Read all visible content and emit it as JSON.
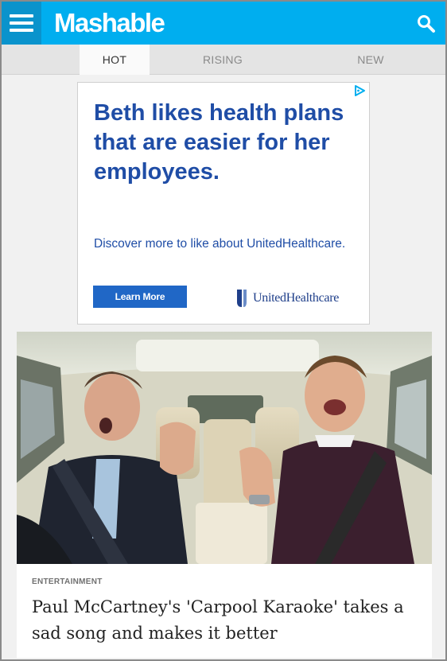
{
  "header": {
    "logo_text": "Mashable",
    "menu_icon": "hamburger-menu-icon",
    "search_icon": "search-icon",
    "brand_color": "#00aeef"
  },
  "tabs": [
    {
      "label": "HOT",
      "active": true
    },
    {
      "label": "RISING",
      "active": false
    },
    {
      "label": "NEW",
      "active": false
    }
  ],
  "ad": {
    "headline": "Beth likes health plans that are easier for her employees.",
    "body": "Discover more to like about UnitedHealthcare.",
    "cta_label": "Learn More",
    "brand_name": "UnitedHealthcare",
    "adchoices_icon": "adchoices-icon"
  },
  "article": {
    "category": "ENTERTAINMENT",
    "headline": "Paul McCartney's 'Carpool Karaoke' takes a sad song and makes it better"
  }
}
